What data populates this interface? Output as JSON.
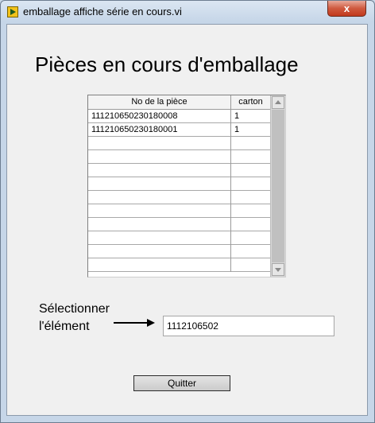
{
  "window": {
    "title": "emballage affiche série en cours.vi",
    "close_label": "x"
  },
  "heading": "Pièces en cours d'emballage",
  "table": {
    "headers": [
      "No de la pièce",
      "carton"
    ],
    "rows": [
      [
        "111210650230180008",
        "1"
      ],
      [
        "111210650230180001",
        "1"
      ],
      [
        "",
        ""
      ],
      [
        "",
        ""
      ],
      [
        "",
        ""
      ],
      [
        "",
        ""
      ],
      [
        "",
        ""
      ],
      [
        "",
        ""
      ],
      [
        "",
        ""
      ],
      [
        "",
        ""
      ],
      [
        "",
        ""
      ],
      [
        "",
        ""
      ]
    ]
  },
  "selection": {
    "label_line1": "Sélectionner",
    "label_line2": "l'élément",
    "value": "1112106502"
  },
  "quit_button": "Quitter"
}
